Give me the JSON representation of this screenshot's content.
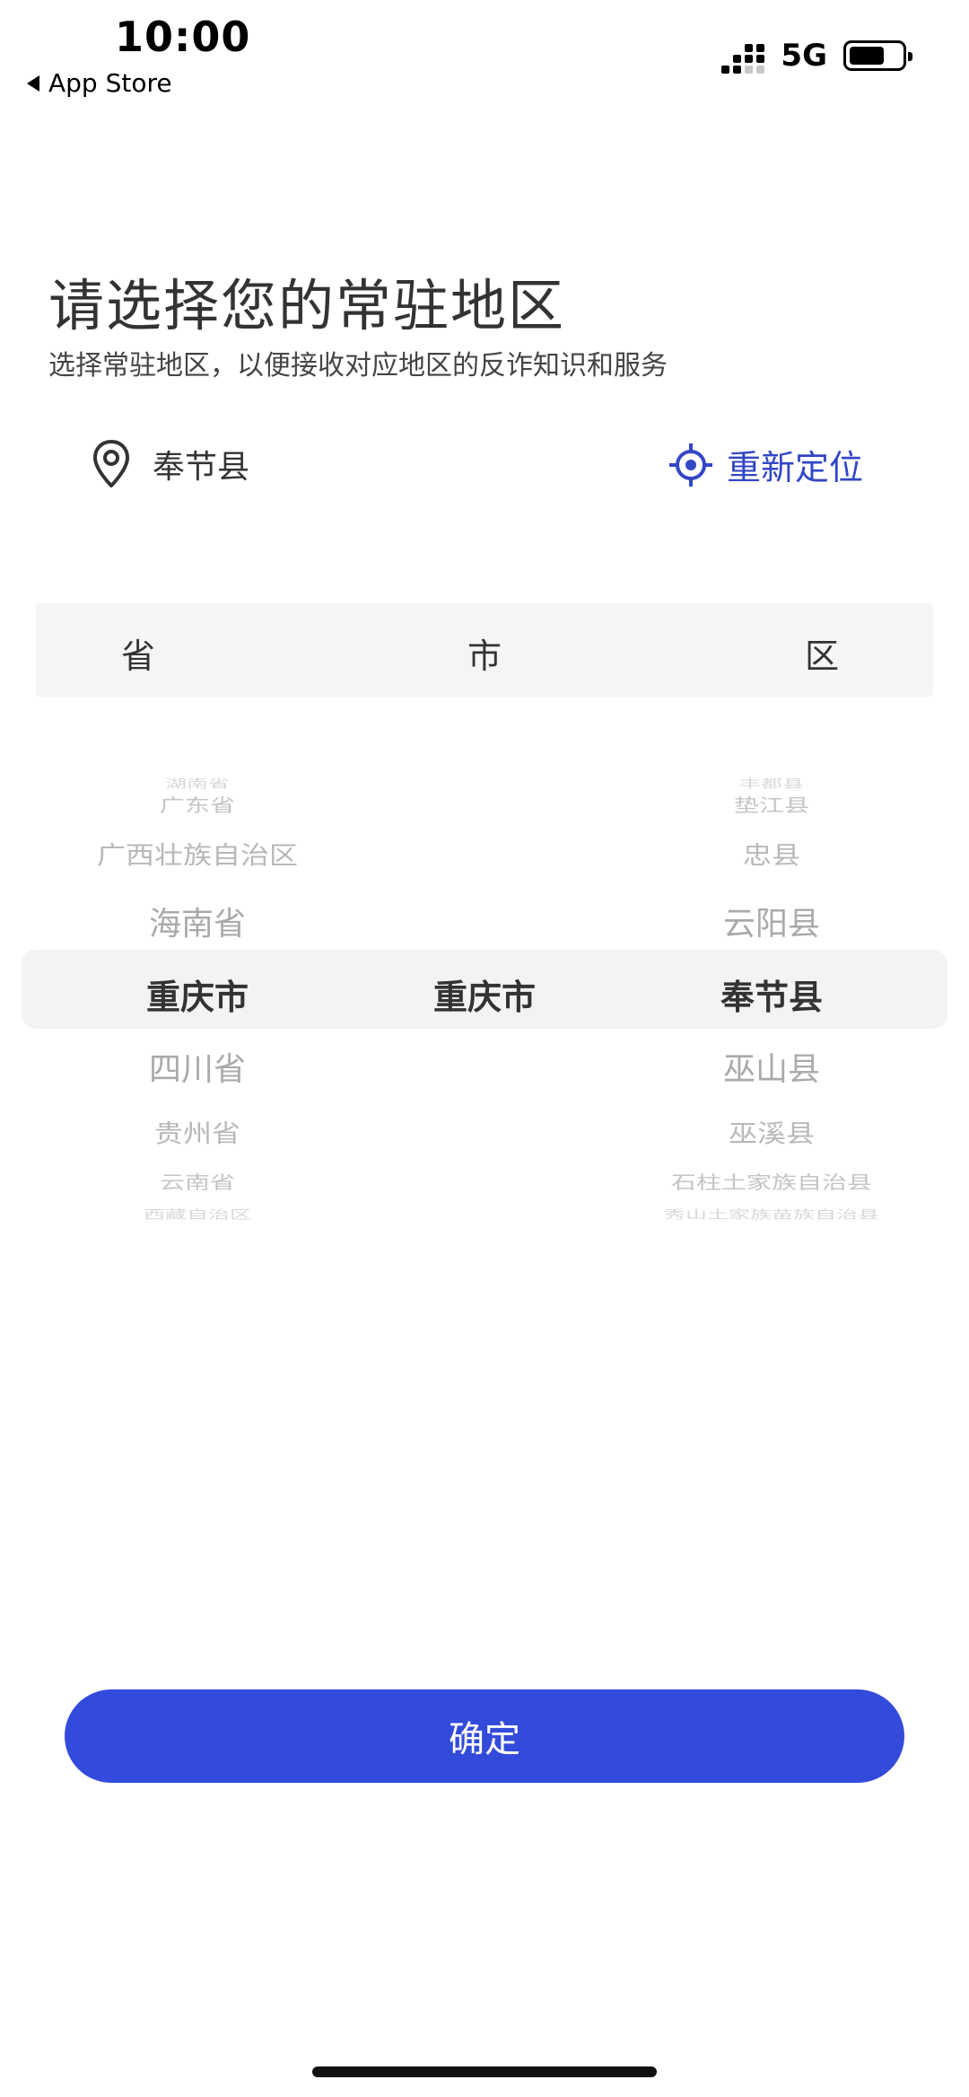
{
  "status_bar": {
    "time": "10:00",
    "back_label": "App Store",
    "network": "5G"
  },
  "header": {
    "title": "请选择您的常驻地区",
    "subtitle": "选择常驻地区，以便接收对应地区的反诈知识和服务"
  },
  "location": {
    "current": "奉节县",
    "icon": "location-pin-icon",
    "relocate_label": "重新定位",
    "relocate_icon": "crosshair-icon"
  },
  "picker": {
    "columns": [
      "省",
      "市",
      "区"
    ],
    "provinces": [
      "湖南省",
      "广东省",
      "广西壮族自治区",
      "海南省",
      "重庆市",
      "四川省",
      "贵州省",
      "云南省",
      "西藏自治区"
    ],
    "cities": [
      "重庆市"
    ],
    "districts": [
      "丰都县",
      "垫江县",
      "忠县",
      "云阳县",
      "奉节县",
      "巫山县",
      "巫溪县",
      "石柱土家族自治县",
      "秀山土家族苗族自治县"
    ],
    "selected": {
      "province": "重庆市",
      "city": "重庆市",
      "district": "奉节县"
    }
  },
  "confirm_label": "确定",
  "colors": {
    "accent": "#334bdb",
    "link": "#3346c6",
    "header_bg": "#f5f5f5"
  }
}
